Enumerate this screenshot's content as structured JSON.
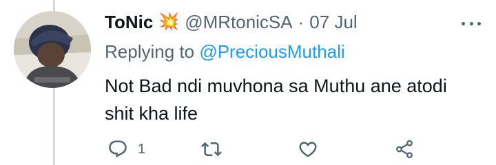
{
  "tweet": {
    "display_name": "ToNic",
    "name_emoji": "💥",
    "handle": "@MRtonicSA",
    "separator": "·",
    "date": "07 Jul",
    "replying_prefix": "Replying to",
    "replying_mention": "@PreciousMuthali",
    "text": "Not Bad ndi muvhona sa Muthu ane atodi shit kha life",
    "more_icon": "more-dots-icon"
  },
  "actions": {
    "reply": {
      "icon": "reply-bubble-icon",
      "count": "1"
    },
    "retweet": {
      "icon": "retweet-icon",
      "count": ""
    },
    "like": {
      "icon": "heart-icon",
      "count": ""
    },
    "share": {
      "icon": "share-icon",
      "count": ""
    }
  },
  "colors": {
    "text": "#0f1419",
    "secondary": "#536471",
    "accent": "#1d9bf0",
    "thread_line": "#cfd9de"
  }
}
